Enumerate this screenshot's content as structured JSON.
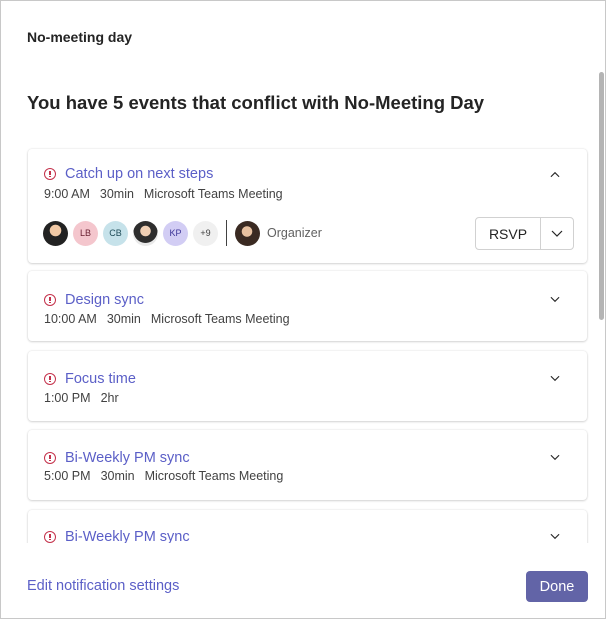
{
  "dialog": {
    "title": "No-meeting day",
    "heading": "You have 5 events that conflict with No-Meeting Day"
  },
  "events": [
    {
      "title": "Catch up on next steps",
      "time": "9:00 AM",
      "duration": "30min",
      "location": "Microsoft Teams Meeting",
      "expanded": true,
      "attendees": [
        "LB",
        "CB",
        "KP"
      ],
      "more_count": "+9",
      "organizer_label": "Organizer",
      "rsvp_label": "RSVP"
    },
    {
      "title": "Design sync",
      "time": "10:00 AM",
      "duration": "30min",
      "location": "Microsoft Teams Meeting",
      "expanded": false
    },
    {
      "title": "Focus time",
      "time": "1:00 PM",
      "duration": "2hr",
      "location": "",
      "expanded": false
    },
    {
      "title": "Bi-Weekly PM sync",
      "time": "5:00 PM",
      "duration": "30min",
      "location": "Microsoft Teams Meeting",
      "expanded": false
    },
    {
      "title": "Bi-Weekly PM sync",
      "expanded": false
    }
  ],
  "footer": {
    "settings_link": "Edit notification settings",
    "done_label": "Done"
  },
  "colors": {
    "accent": "#5b5fc7",
    "primary_button": "#6264a7",
    "alert": "#c4314b"
  }
}
